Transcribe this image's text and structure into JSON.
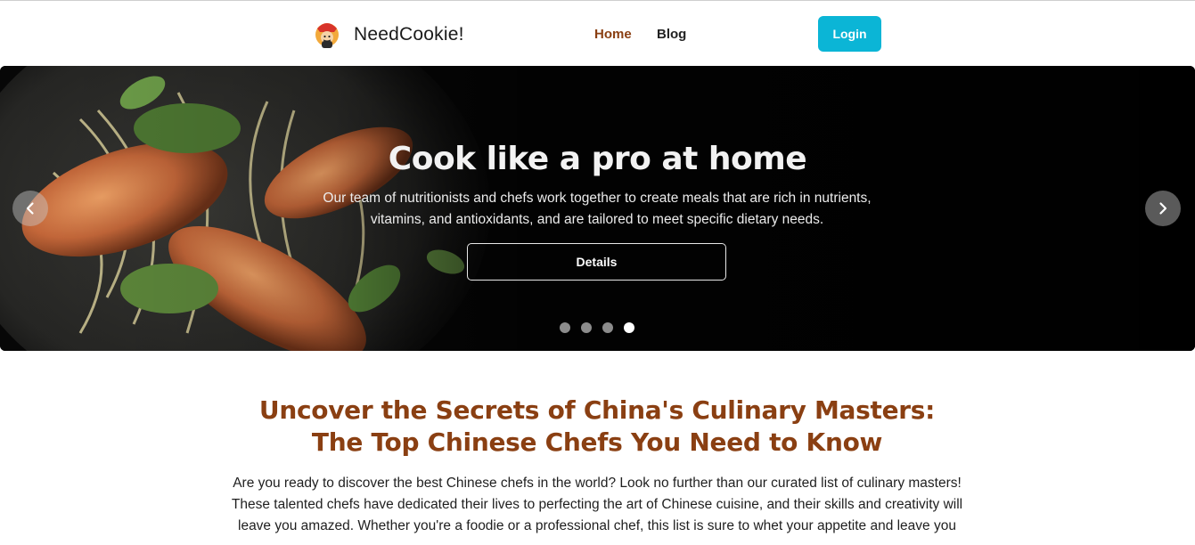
{
  "nav": {
    "brand_name": "NeedCookie!",
    "links": [
      {
        "label": "Home",
        "active": true
      },
      {
        "label": "Blog",
        "active": false
      }
    ],
    "login_label": "Login"
  },
  "hero": {
    "title": "Cook like a pro at home",
    "text": "Our team of nutritionists and chefs work together to create meals that are rich in nutrients, vitamins, and antioxidants, and are tailored to meet specific dietary needs.",
    "button_label": "Details",
    "slide_count": 4,
    "active_slide": 4
  },
  "article": {
    "title_line1": "Uncover the Secrets of China's Culinary Masters:",
    "title_line2": "The Top Chinese Chefs You Need to Know",
    "text": "Are you ready to discover the best Chinese chefs in the world? Look no further than our curated list of culinary masters! These talented chefs have dedicated their lives to perfecting the art of Chinese cuisine, and their skills and creativity will leave you amazed. Whether you're a foodie or a professional chef, this list is sure to whet your appetite and leave you"
  },
  "colors": {
    "accent_brown": "#8a3f12",
    "login_cyan": "#0bb5d6"
  },
  "icons": {
    "brand": "chef-logo-icon",
    "prev": "chevron-left-icon",
    "next": "chevron-right-icon"
  }
}
